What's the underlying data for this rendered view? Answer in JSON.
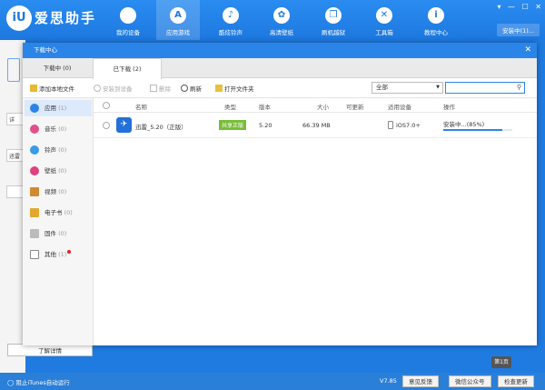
{
  "app": {
    "logo_letter": "iU",
    "name": "爱思助手",
    "nav": [
      {
        "label": "我的设备",
        "icon": ""
      },
      {
        "label": "应用游戏",
        "icon": "A"
      },
      {
        "label": "酷炫铃声",
        "icon": "♪"
      },
      {
        "label": "高清壁纸",
        "icon": "✿"
      },
      {
        "label": "刷机越狱",
        "icon": "❒"
      },
      {
        "label": "工具箱",
        "icon": "✕"
      },
      {
        "label": "教程中心",
        "icon": "i"
      }
    ],
    "window_controls": [
      "▾",
      "—",
      "☐",
      "✕"
    ],
    "install_status": "安装中(1)..."
  },
  "dialog": {
    "title": "下载中心",
    "close": "✕",
    "tabs": [
      {
        "label": "下载中 (0)",
        "active": false
      },
      {
        "label": "已下载 (2)",
        "active": true
      }
    ],
    "toolbar": {
      "add_local": "添加本地文件",
      "install_device": "安装到设备",
      "delete": "删除",
      "refresh": "刷新",
      "open_folder": "打开文件夹",
      "filter_value": "全部",
      "filter_arrow": "▼",
      "search_placeholder": ""
    },
    "categories": [
      {
        "name": "应用",
        "count": "(1)",
        "color": "#2b85e8",
        "active": true
      },
      {
        "name": "音乐",
        "count": "(0)",
        "color": "#e0508a",
        "active": false
      },
      {
        "name": "铃声",
        "count": "(0)",
        "color": "#3a9be8",
        "active": false
      },
      {
        "name": "壁纸",
        "count": "(0)",
        "color": "#e04080",
        "active": false
      },
      {
        "name": "视频",
        "count": "(0)",
        "color": "#d08a30",
        "active": false
      },
      {
        "name": "电子书",
        "count": "(0)",
        "color": "#e0a830",
        "active": false
      },
      {
        "name": "固件",
        "count": "(0)",
        "color": "#aaaaaa",
        "active": false
      },
      {
        "name": "其他",
        "count": "(1)",
        "color": "#888888",
        "active": false
      }
    ],
    "columns": {
      "name": "名称",
      "type": "类型",
      "version": "版本",
      "size": "大小",
      "updatable": "可更新",
      "devices": "适用设备",
      "action": "操作"
    },
    "rows": [
      {
        "name": "迅雷_5.20（正版）",
        "type": "共享正版",
        "version": "5.20",
        "size": "66.39 MB",
        "updatable": "",
        "devices": "iOS7.0+",
        "status": "安装中...(85%)",
        "progress": 0.85
      }
    ]
  },
  "background": {
    "left_buttons": [
      "详",
      "迅雷",
      ""
    ],
    "detail_button": "了解详情",
    "page_badge": "第1页"
  },
  "status_bar": {
    "itunes": "阻止iTunes自动运行",
    "version": "V7.85",
    "feedback": "意见反馈",
    "wechat": "微信公众号",
    "update": "检查更新"
  }
}
